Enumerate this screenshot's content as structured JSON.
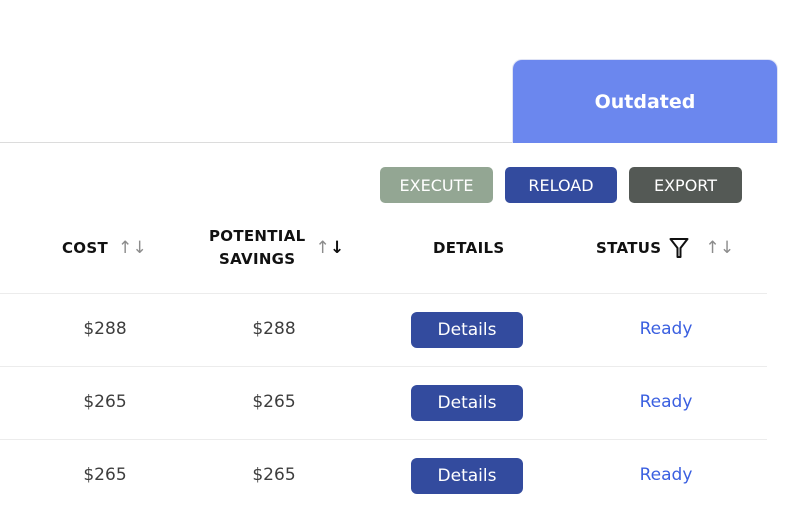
{
  "tab": {
    "label": "Outdated",
    "color": "#6b87ee"
  },
  "toolbar": {
    "execute_label": "EXECUTE",
    "reload_label": "RELOAD",
    "export_label": "EXPORT"
  },
  "table": {
    "columns": [
      {
        "label": "COST",
        "sortable": true,
        "sort": "none"
      },
      {
        "label_line1": "POTENTIAL",
        "label_line2": "SAVINGS",
        "sortable": true,
        "sort": "descending"
      },
      {
        "label": "DETAILS",
        "sortable": false
      },
      {
        "label": "STATUS",
        "sortable": true,
        "filterable": true,
        "sort": "none"
      }
    ],
    "sort_icons": {
      "up": "↑",
      "down": "↓"
    },
    "rows": [
      {
        "cost": "$288",
        "savings": "$288",
        "details_label": "Details",
        "status": "Ready"
      },
      {
        "cost": "$265",
        "savings": "$265",
        "details_label": "Details",
        "status": "Ready"
      },
      {
        "cost": "$265",
        "savings": "$265",
        "details_label": "Details",
        "status": "Ready"
      }
    ]
  },
  "colors": {
    "execute": "#93a693",
    "reload": "#334b9e",
    "export": "#545955",
    "status_link": "#3a5fe0"
  }
}
